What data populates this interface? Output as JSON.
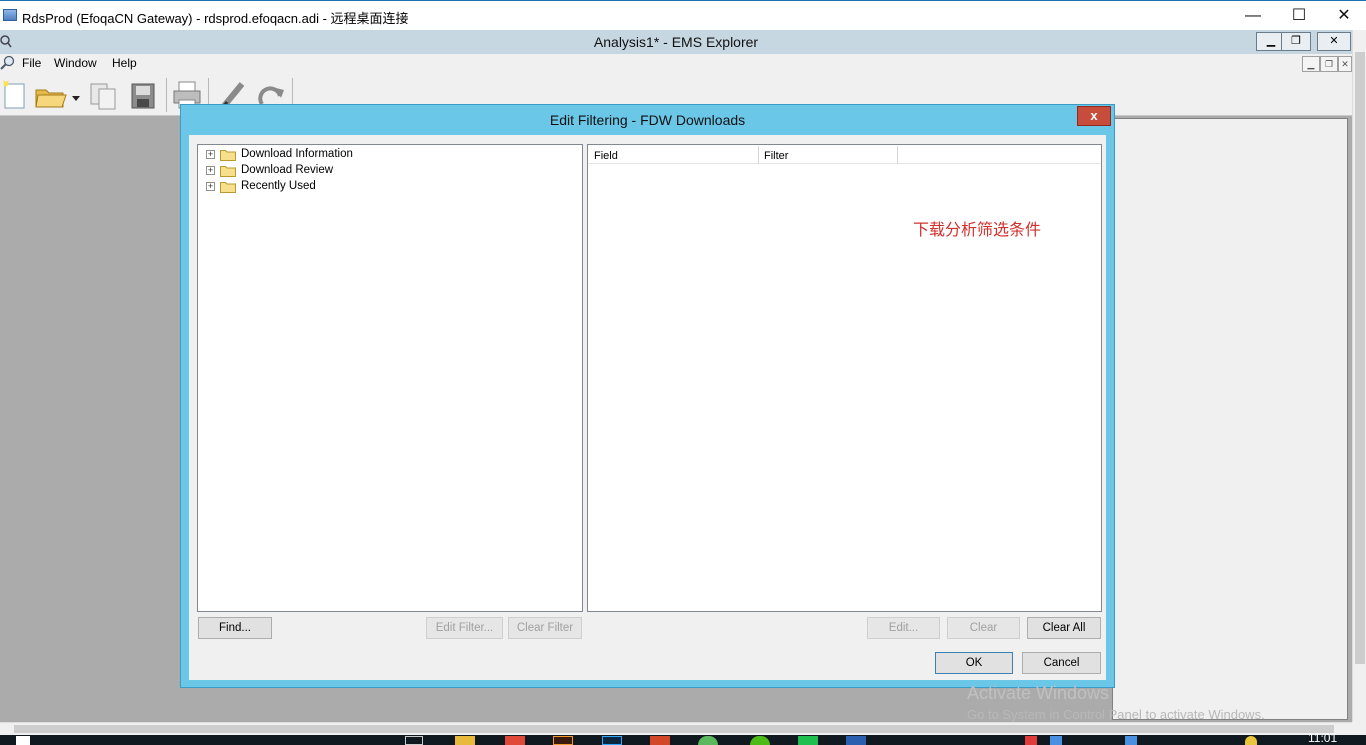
{
  "rdp_window": {
    "title": "RdsProd (EfoqaCN Gateway) - rdsprod.efoqacn.adi - 远程桌面连接",
    "minimize": "—",
    "maximize": "☐",
    "close": "✕"
  },
  "app_window": {
    "title": "Analysis1* - EMS Explorer",
    "minimize": "▁",
    "restore": "❐",
    "close": "✕"
  },
  "menu": {
    "items": [
      "File",
      "Window",
      "Help"
    ]
  },
  "toolbar": {
    "buttons": [
      "new-icon",
      "open-icon",
      "copy-icon",
      "save-icon",
      "print-icon",
      "edit-icon",
      "refresh-icon"
    ]
  },
  "dialog": {
    "title": "Edit Filtering - FDW Downloads",
    "close": "x",
    "tree": [
      {
        "label": "Download Information",
        "expander": "+"
      },
      {
        "label": "Download Review",
        "expander": "+"
      },
      {
        "label": "Recently Used",
        "expander": "+"
      }
    ],
    "grid": {
      "headers": [
        "Field",
        "Filter"
      ],
      "annotation": "下载分析筛选条件"
    },
    "buttons": {
      "find": "Find...",
      "edit_filter": "Edit Filter...",
      "clear_filter": "Clear Filter",
      "edit": "Edit...",
      "clear": "Clear",
      "clear_all": "Clear All",
      "ok": "OK",
      "cancel": "Cancel"
    }
  },
  "watermark": {
    "title": "Activate Windows",
    "subtitle": "Go to System in Control Panel to activate Windows."
  },
  "taskbar": {
    "clock": "11:01"
  },
  "colors": {
    "dialog_frame": "#6ac7e8",
    "close_red": "#c74c3c",
    "annotation_red": "#d0312d"
  }
}
